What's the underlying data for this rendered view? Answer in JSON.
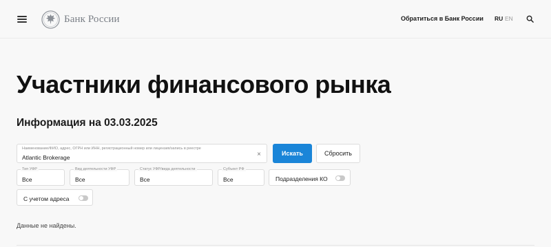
{
  "header": {
    "logo_text": "Банк России",
    "appeal_link": "Обратиться в Банк России",
    "lang_ru": "RU",
    "lang_en": "EN"
  },
  "page": {
    "title": "Участники финансового рынка",
    "info_title": "Информация на 03.03.2025"
  },
  "search": {
    "label": "Наименование/ФИО, адрес, ОГРН или ИНН, регистрационный номер или лицензия/запись в реестре",
    "value": "Atlantic Brokerage",
    "clear_glyph": "×",
    "submit_label": "Искать",
    "reset_label": "Сбросить"
  },
  "filters": [
    {
      "label": "Тип УФР",
      "value": "Все"
    },
    {
      "label": "Вид деятельности УФР",
      "value": "Все"
    },
    {
      "label": "Статус УФР/вида деятельности",
      "value": "Все"
    },
    {
      "label": "Субъект РФ",
      "value": "Все"
    }
  ],
  "toggles": {
    "branches_label": "Подразделения КО",
    "branches_on": false,
    "address_label": "С учетом адреса",
    "address_on": false
  },
  "results": {
    "empty_message": "Данные не найдены."
  },
  "colors": {
    "accent": "#1a85d8",
    "background": "#f8f8f8"
  }
}
